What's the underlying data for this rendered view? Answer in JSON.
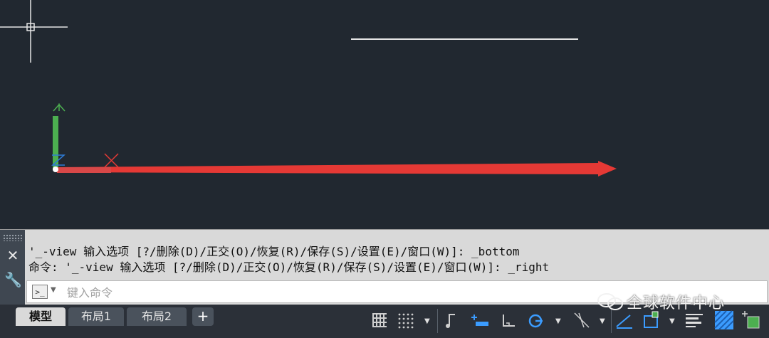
{
  "command_history": [
    "'_-view 输入选项 [?/删除(D)/正交(O)/恢复(R)/保存(S)/设置(E)/窗口(W)]: _bottom",
    "命令: '_-view 输入选项 [?/删除(D)/正交(O)/恢复(R)/保存(S)/设置(E)/窗口(W)]: _right"
  ],
  "command_input": {
    "placeholder": "键入命令",
    "value": ""
  },
  "command_prompt_icon": "command-prompt-icon",
  "ucs": {
    "y_label": "Y",
    "x_label": "X"
  },
  "layout_tabs": [
    {
      "label": "模型",
      "active": true
    },
    {
      "label": "布局1",
      "active": false
    },
    {
      "label": "布局2",
      "active": false
    }
  ],
  "add_tab_label": "+",
  "watermark": "全球软件中心",
  "colors": {
    "canvas_bg": "#212830",
    "axis_x": "#e53935",
    "axis_y": "#4caf50",
    "axis_z": "#2e7bd6",
    "line": "#e6e6e6",
    "panel_bg": "#d9d9d9",
    "status_bg": "#2b3038",
    "accent_blue": "#3b9cff"
  }
}
